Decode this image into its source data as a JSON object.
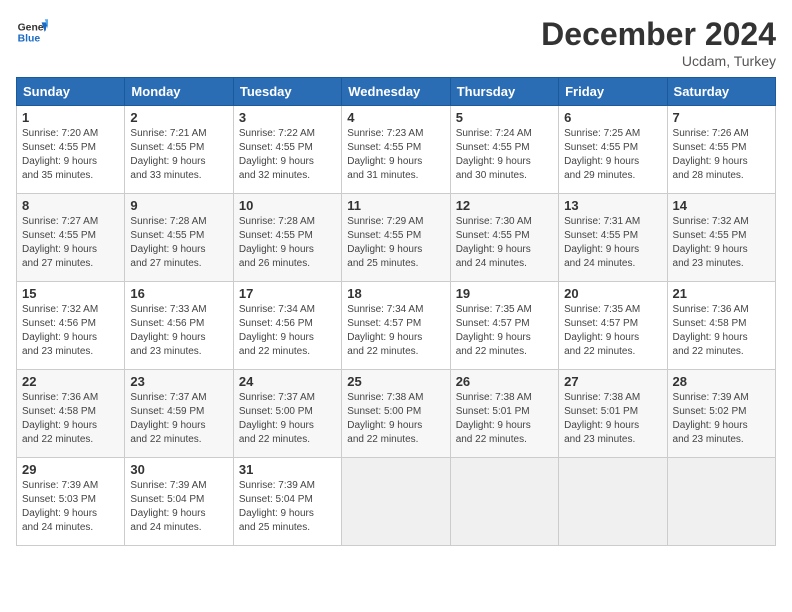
{
  "logo": {
    "line1": "General",
    "line2": "Blue"
  },
  "title": "December 2024",
  "subtitle": "Ucdam, Turkey",
  "days_header": [
    "Sunday",
    "Monday",
    "Tuesday",
    "Wednesday",
    "Thursday",
    "Friday",
    "Saturday"
  ],
  "weeks": [
    [
      {
        "day": 1,
        "info": "Sunrise: 7:20 AM\nSunset: 4:55 PM\nDaylight: 9 hours\nand 35 minutes."
      },
      {
        "day": 2,
        "info": "Sunrise: 7:21 AM\nSunset: 4:55 PM\nDaylight: 9 hours\nand 33 minutes."
      },
      {
        "day": 3,
        "info": "Sunrise: 7:22 AM\nSunset: 4:55 PM\nDaylight: 9 hours\nand 32 minutes."
      },
      {
        "day": 4,
        "info": "Sunrise: 7:23 AM\nSunset: 4:55 PM\nDaylight: 9 hours\nand 31 minutes."
      },
      {
        "day": 5,
        "info": "Sunrise: 7:24 AM\nSunset: 4:55 PM\nDaylight: 9 hours\nand 30 minutes."
      },
      {
        "day": 6,
        "info": "Sunrise: 7:25 AM\nSunset: 4:55 PM\nDaylight: 9 hours\nand 29 minutes."
      },
      {
        "day": 7,
        "info": "Sunrise: 7:26 AM\nSunset: 4:55 PM\nDaylight: 9 hours\nand 28 minutes."
      }
    ],
    [
      {
        "day": 8,
        "info": "Sunrise: 7:27 AM\nSunset: 4:55 PM\nDaylight: 9 hours\nand 27 minutes."
      },
      {
        "day": 9,
        "info": "Sunrise: 7:28 AM\nSunset: 4:55 PM\nDaylight: 9 hours\nand 27 minutes."
      },
      {
        "day": 10,
        "info": "Sunrise: 7:28 AM\nSunset: 4:55 PM\nDaylight: 9 hours\nand 26 minutes."
      },
      {
        "day": 11,
        "info": "Sunrise: 7:29 AM\nSunset: 4:55 PM\nDaylight: 9 hours\nand 25 minutes."
      },
      {
        "day": 12,
        "info": "Sunrise: 7:30 AM\nSunset: 4:55 PM\nDaylight: 9 hours\nand 24 minutes."
      },
      {
        "day": 13,
        "info": "Sunrise: 7:31 AM\nSunset: 4:55 PM\nDaylight: 9 hours\nand 24 minutes."
      },
      {
        "day": 14,
        "info": "Sunrise: 7:32 AM\nSunset: 4:55 PM\nDaylight: 9 hours\nand 23 minutes."
      }
    ],
    [
      {
        "day": 15,
        "info": "Sunrise: 7:32 AM\nSunset: 4:56 PM\nDaylight: 9 hours\nand 23 minutes."
      },
      {
        "day": 16,
        "info": "Sunrise: 7:33 AM\nSunset: 4:56 PM\nDaylight: 9 hours\nand 23 minutes."
      },
      {
        "day": 17,
        "info": "Sunrise: 7:34 AM\nSunset: 4:56 PM\nDaylight: 9 hours\nand 22 minutes."
      },
      {
        "day": 18,
        "info": "Sunrise: 7:34 AM\nSunset: 4:57 PM\nDaylight: 9 hours\nand 22 minutes."
      },
      {
        "day": 19,
        "info": "Sunrise: 7:35 AM\nSunset: 4:57 PM\nDaylight: 9 hours\nand 22 minutes."
      },
      {
        "day": 20,
        "info": "Sunrise: 7:35 AM\nSunset: 4:57 PM\nDaylight: 9 hours\nand 22 minutes."
      },
      {
        "day": 21,
        "info": "Sunrise: 7:36 AM\nSunset: 4:58 PM\nDaylight: 9 hours\nand 22 minutes."
      }
    ],
    [
      {
        "day": 22,
        "info": "Sunrise: 7:36 AM\nSunset: 4:58 PM\nDaylight: 9 hours\nand 22 minutes."
      },
      {
        "day": 23,
        "info": "Sunrise: 7:37 AM\nSunset: 4:59 PM\nDaylight: 9 hours\nand 22 minutes."
      },
      {
        "day": 24,
        "info": "Sunrise: 7:37 AM\nSunset: 5:00 PM\nDaylight: 9 hours\nand 22 minutes."
      },
      {
        "day": 25,
        "info": "Sunrise: 7:38 AM\nSunset: 5:00 PM\nDaylight: 9 hours\nand 22 minutes."
      },
      {
        "day": 26,
        "info": "Sunrise: 7:38 AM\nSunset: 5:01 PM\nDaylight: 9 hours\nand 22 minutes."
      },
      {
        "day": 27,
        "info": "Sunrise: 7:38 AM\nSunset: 5:01 PM\nDaylight: 9 hours\nand 23 minutes."
      },
      {
        "day": 28,
        "info": "Sunrise: 7:39 AM\nSunset: 5:02 PM\nDaylight: 9 hours\nand 23 minutes."
      }
    ],
    [
      {
        "day": 29,
        "info": "Sunrise: 7:39 AM\nSunset: 5:03 PM\nDaylight: 9 hours\nand 24 minutes."
      },
      {
        "day": 30,
        "info": "Sunrise: 7:39 AM\nSunset: 5:04 PM\nDaylight: 9 hours\nand 24 minutes."
      },
      {
        "day": 31,
        "info": "Sunrise: 7:39 AM\nSunset: 5:04 PM\nDaylight: 9 hours\nand 25 minutes."
      },
      null,
      null,
      null,
      null
    ]
  ]
}
